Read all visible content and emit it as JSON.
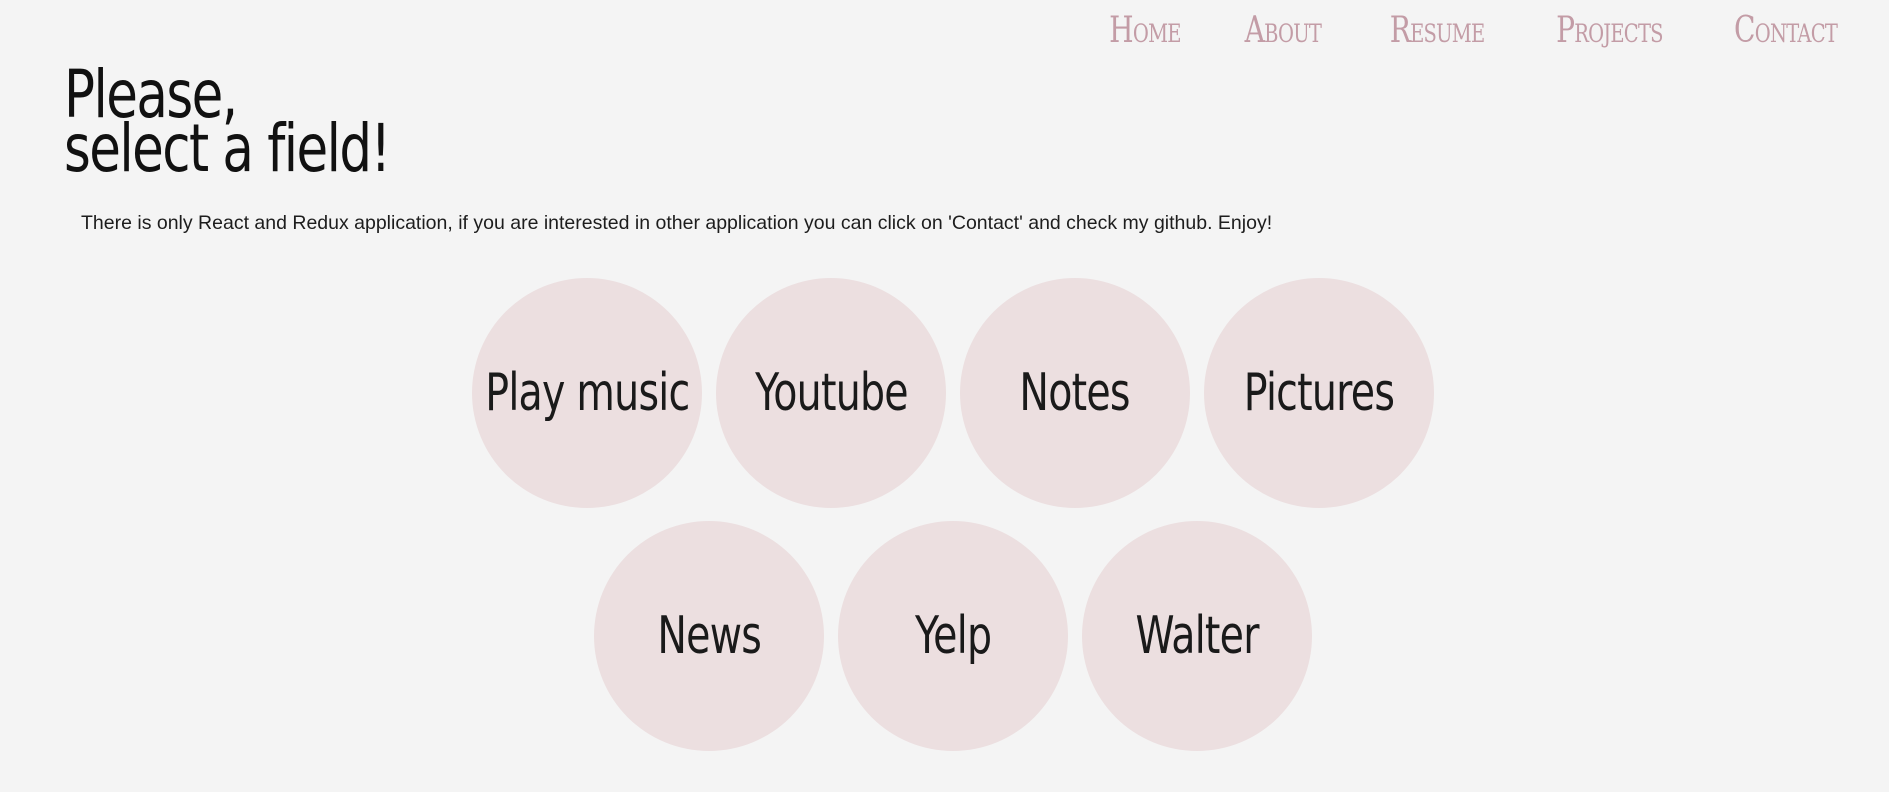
{
  "nav": {
    "items": [
      {
        "label": "Home"
      },
      {
        "label": "About"
      },
      {
        "label": "Resume"
      },
      {
        "label": "Projects"
      },
      {
        "label": "Contact"
      }
    ]
  },
  "header": {
    "title_line1": "Please,",
    "title_line2": "select a field!",
    "subtitle": "There is only React and Redux application, if you are interested in other application you can click on 'Contact' and check my github. Enjoy!"
  },
  "fields": [
    {
      "label": "Play music"
    },
    {
      "label": "Youtube"
    },
    {
      "label": "Notes"
    },
    {
      "label": "Pictures"
    },
    {
      "label": "News"
    },
    {
      "label": "Yelp"
    },
    {
      "label": "Walter"
    }
  ],
  "colors": {
    "background": "#f4f4f4",
    "nav_text": "#c39ca6",
    "circle_fill": "#ecdfe0",
    "text": "#111111"
  }
}
